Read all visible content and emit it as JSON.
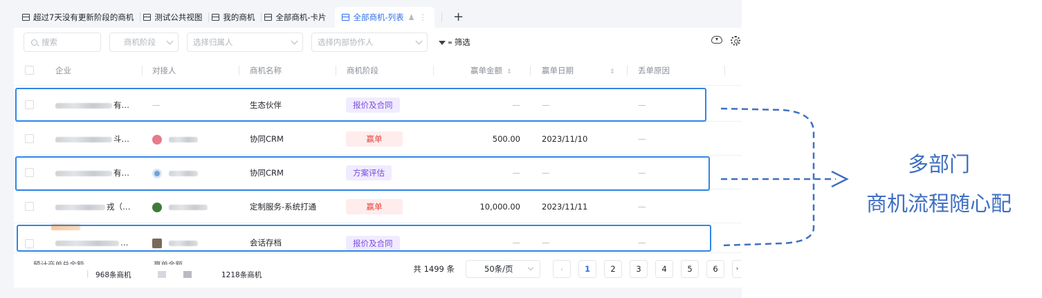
{
  "tabs": [
    {
      "label": "超过7天没有更新阶段的商机",
      "active": false
    },
    {
      "label": "测试公共视图",
      "active": false
    },
    {
      "label": "我的商机",
      "active": false
    },
    {
      "label": "全部商机-卡片",
      "active": false
    },
    {
      "label": "全部商机-列表",
      "active": true
    }
  ],
  "toolbar": {
    "search_placeholder": "搜索",
    "stage_filter": "商机阶段",
    "owner_filter": "选择归属人",
    "collaborator_filter": "选择内部协作人",
    "filter_label": "筛选"
  },
  "columns": {
    "company": "企业",
    "contact": "对接人",
    "name": "商机名称",
    "stage": "商机阶段",
    "amount": "赢单金额",
    "date": "赢单日期",
    "loss_reason": "丢单原因"
  },
  "rows": [
    {
      "company_suffix": "有…",
      "contact": "—",
      "name": "生态伙伴",
      "stage": "报价及合同",
      "amount": "—",
      "date": "—",
      "loss_reason": "—"
    },
    {
      "company_suffix": "斗…",
      "contact": "",
      "name": "协同CRM",
      "stage": "赢单",
      "amount": "500.00",
      "date": "2023/11/10",
      "loss_reason": "—"
    },
    {
      "company_suffix": "有…",
      "contact": "",
      "name": "协同CRM",
      "stage": "方案评估",
      "amount": "—",
      "date": "—",
      "loss_reason": "—"
    },
    {
      "company_suffix": "戎（…",
      "contact": "",
      "name": "定制服务-系统打通",
      "stage": "赢单",
      "amount": "10,000.00",
      "date": "2023/11/11",
      "loss_reason": "—"
    },
    {
      "company_suffix": "…",
      "contact": "",
      "name": "会话存档",
      "stage": "报价及合同",
      "amount": "—",
      "date": "—",
      "loss_reason": "—"
    }
  ],
  "footer": {
    "est_total_label": "预计商单总金额",
    "won_total_label": "赢单金额",
    "left_count": "968条商机",
    "right_count": "1218条商机"
  },
  "pagination": {
    "total": "共 1499 条",
    "page_size": "50条/页",
    "pages": [
      "1",
      "2",
      "3",
      "4",
      "5",
      "6"
    ],
    "current": "1"
  },
  "annotation": {
    "line1": "多部门",
    "line2": "商机流程随心配"
  },
  "colors": {
    "accent": "#2e6fe8",
    "highlight_box": "#2f86e6",
    "annotation": "#3f6fc4",
    "tag_purple_bg": "#f1ebff",
    "tag_purple_fg": "#7a4de0",
    "tag_red_bg": "#ffecec",
    "tag_red_fg": "#e8453c"
  }
}
